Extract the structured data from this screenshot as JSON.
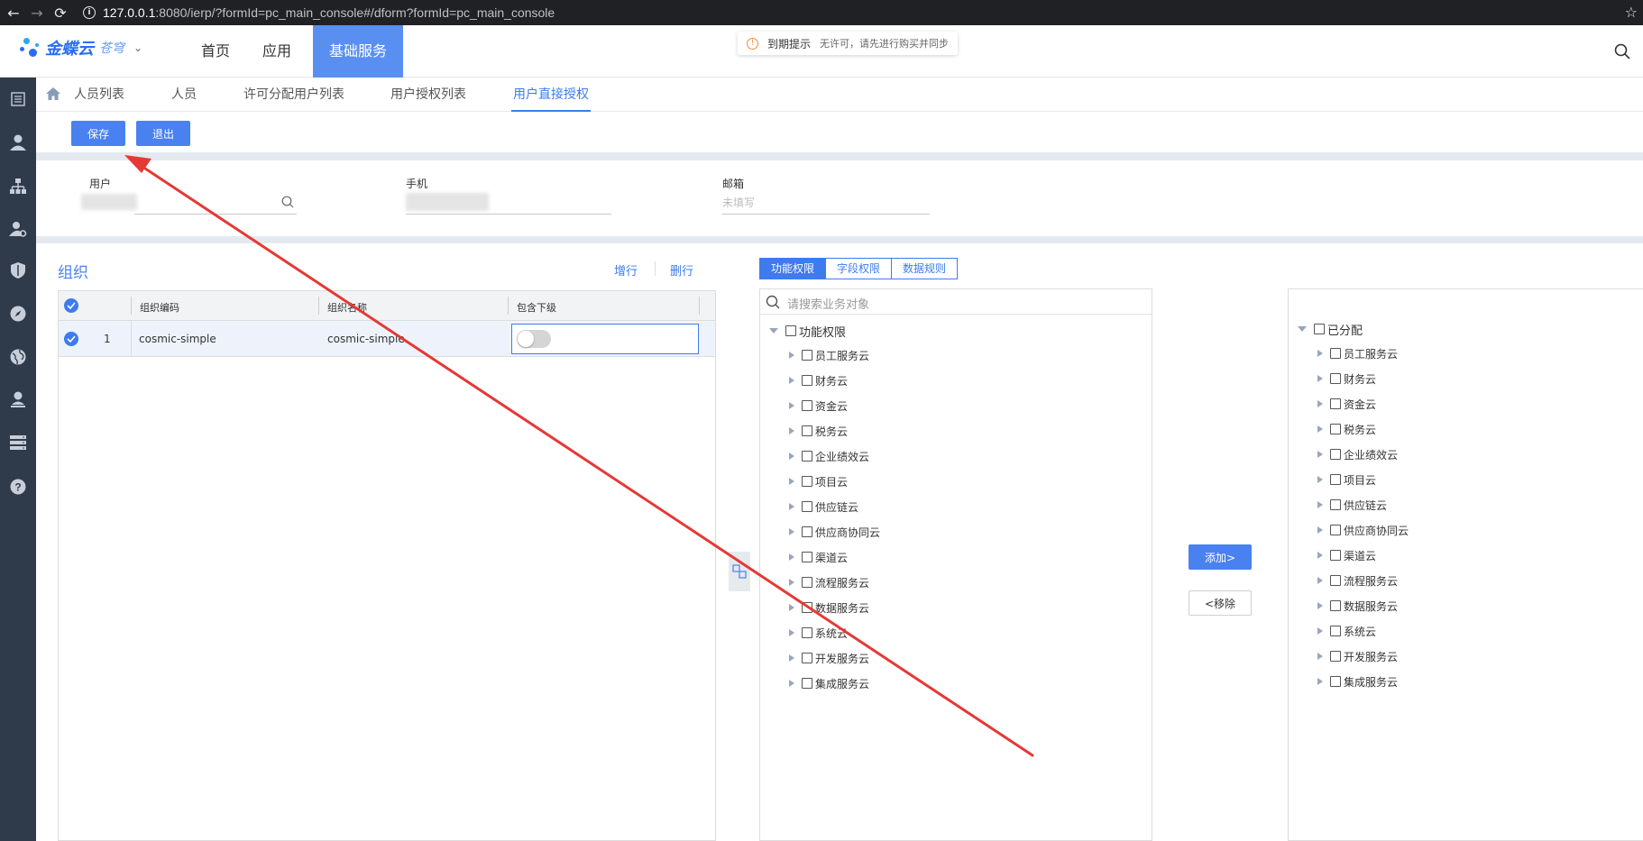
{
  "browser": {
    "url_host": "127.0.0.1",
    "url_rest": ":8080/ierp/?formId=pc_main_console#/dform?formId=pc_main_console"
  },
  "header": {
    "logo_text": "金蝶云",
    "logo_sub": "苍穹",
    "nav": [
      "首页",
      "应用",
      "基础服务"
    ],
    "notice_title": "到期提示",
    "notice_msg": "无许可，请先进行购买并同步"
  },
  "tabs": [
    "人员列表",
    "人员",
    "许可分配用户列表",
    "用户授权列表",
    "用户直接授权"
  ],
  "toolbar": {
    "save": "保存",
    "exit": "退出"
  },
  "form": {
    "user_label": "用户",
    "phone_label": "手机",
    "email_label": "邮箱",
    "email_placeholder": "未填写"
  },
  "org": {
    "title": "组织",
    "add_row": "增行",
    "delete_row": "删行",
    "columns": [
      "组织编码",
      "组织名称",
      "包含下级"
    ],
    "rows": [
      {
        "index": "1",
        "code": "cosmic-simple",
        "name": "cosmic-simple"
      }
    ]
  },
  "perm": {
    "tabs": [
      "功能权限",
      "字段权限",
      "数据规则"
    ],
    "search_placeholder": "请搜索业务对象",
    "left_root": "功能权限",
    "right_root": "已分配",
    "items": [
      "员工服务云",
      "财务云",
      "资金云",
      "税务云",
      "企业绩效云",
      "项目云",
      "供应链云",
      "供应商协同云",
      "渠道云",
      "流程服务云",
      "数据服务云",
      "系统云",
      "开发服务云",
      "集成服务云"
    ],
    "add_label": "添加>",
    "remove_label": "<移除"
  },
  "colors": {
    "accent": "#3e7bf0",
    "sidebar": "#2f3a4b",
    "annotation_arrow": "#e53935"
  }
}
